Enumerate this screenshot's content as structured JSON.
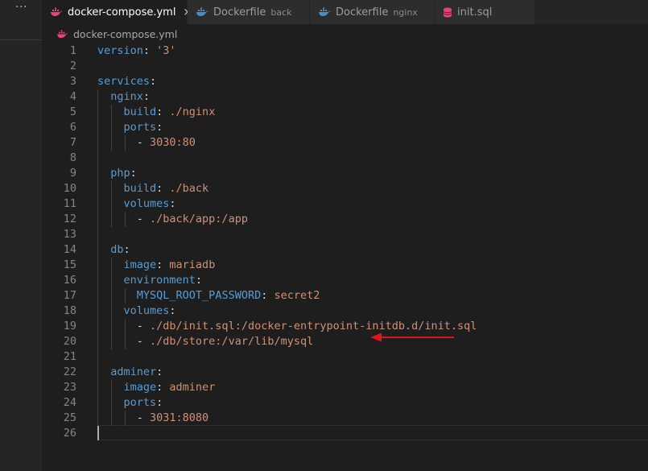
{
  "tabs": [
    {
      "label": "docker-compose.yml",
      "description": "",
      "icon": "docker-whale-icon",
      "active": true,
      "close": "×"
    },
    {
      "label": "Dockerfile",
      "description": "back",
      "icon": "docker-whale-icon",
      "active": false
    },
    {
      "label": "Dockerfile",
      "description": "nginx",
      "icon": "docker-whale-icon",
      "active": false
    },
    {
      "label": "init.sql",
      "description": "",
      "icon": "database-icon",
      "active": false
    }
  ],
  "sidebar": {
    "more_label": "···"
  },
  "breadcrumb": {
    "file": "docker-compose.yml",
    "icon": "docker-whale-icon"
  },
  "colors": {
    "key": "#569cd6",
    "string": "#ce9178",
    "punct": "#d4d4d4",
    "line_number": "#858585",
    "arrow": "#e0161e"
  },
  "code": {
    "lines": [
      {
        "n": "1",
        "tokens": [
          [
            "k",
            "version"
          ],
          [
            "p",
            ": "
          ],
          [
            "s",
            "'3'"
          ]
        ]
      },
      {
        "n": "2",
        "tokens": []
      },
      {
        "n": "3",
        "tokens": [
          [
            "k",
            "services"
          ],
          [
            "p",
            ":"
          ]
        ]
      },
      {
        "n": "4",
        "tokens": [
          [
            "p",
            "  "
          ],
          [
            "k",
            "nginx"
          ],
          [
            "p",
            ":"
          ]
        ]
      },
      {
        "n": "5",
        "tokens": [
          [
            "p",
            "    "
          ],
          [
            "k",
            "build"
          ],
          [
            "p",
            ": "
          ],
          [
            "s",
            "./nginx"
          ]
        ]
      },
      {
        "n": "6",
        "tokens": [
          [
            "p",
            "    "
          ],
          [
            "k",
            "ports"
          ],
          [
            "p",
            ":"
          ]
        ]
      },
      {
        "n": "7",
        "tokens": [
          [
            "p",
            "      - "
          ],
          [
            "s",
            "3030:80"
          ]
        ]
      },
      {
        "n": "8",
        "tokens": []
      },
      {
        "n": "9",
        "tokens": [
          [
            "p",
            "  "
          ],
          [
            "k",
            "php"
          ],
          [
            "p",
            ":"
          ]
        ]
      },
      {
        "n": "10",
        "tokens": [
          [
            "p",
            "    "
          ],
          [
            "k",
            "build"
          ],
          [
            "p",
            ": "
          ],
          [
            "s",
            "./back"
          ]
        ]
      },
      {
        "n": "11",
        "tokens": [
          [
            "p",
            "    "
          ],
          [
            "k",
            "volumes"
          ],
          [
            "p",
            ":"
          ]
        ]
      },
      {
        "n": "12",
        "tokens": [
          [
            "p",
            "      - "
          ],
          [
            "s",
            "./back/app:/app"
          ]
        ]
      },
      {
        "n": "13",
        "tokens": []
      },
      {
        "n": "14",
        "tokens": [
          [
            "p",
            "  "
          ],
          [
            "k",
            "db"
          ],
          [
            "p",
            ":"
          ]
        ]
      },
      {
        "n": "15",
        "tokens": [
          [
            "p",
            "    "
          ],
          [
            "k",
            "image"
          ],
          [
            "p",
            ": "
          ],
          [
            "s",
            "mariadb"
          ]
        ]
      },
      {
        "n": "16",
        "tokens": [
          [
            "p",
            "    "
          ],
          [
            "k",
            "environment"
          ],
          [
            "p",
            ":"
          ]
        ]
      },
      {
        "n": "17",
        "tokens": [
          [
            "p",
            "      "
          ],
          [
            "k",
            "MYSQL_ROOT_PASSWORD"
          ],
          [
            "p",
            ": "
          ],
          [
            "s",
            "secret2"
          ]
        ]
      },
      {
        "n": "18",
        "tokens": [
          [
            "p",
            "    "
          ],
          [
            "k",
            "volumes"
          ],
          [
            "p",
            ":"
          ]
        ]
      },
      {
        "n": "19",
        "tokens": [
          [
            "p",
            "      - "
          ],
          [
            "s",
            "./db/init.sql:/docker-entrypoint-initdb.d/init.sql"
          ]
        ]
      },
      {
        "n": "20",
        "tokens": [
          [
            "p",
            "      - "
          ],
          [
            "s",
            "./db/store:/var/lib/mysql"
          ]
        ]
      },
      {
        "n": "21",
        "tokens": []
      },
      {
        "n": "22",
        "tokens": [
          [
            "p",
            "  "
          ],
          [
            "k",
            "adminer"
          ],
          [
            "p",
            ":"
          ]
        ]
      },
      {
        "n": "23",
        "tokens": [
          [
            "p",
            "    "
          ],
          [
            "k",
            "image"
          ],
          [
            "p",
            ": "
          ],
          [
            "s",
            "adminer"
          ]
        ]
      },
      {
        "n": "24",
        "tokens": [
          [
            "p",
            "    "
          ],
          [
            "k",
            "ports"
          ],
          [
            "p",
            ":"
          ]
        ]
      },
      {
        "n": "25",
        "tokens": [
          [
            "p",
            "      - "
          ],
          [
            "s",
            "3031:8080"
          ]
        ]
      },
      {
        "n": "26",
        "tokens": []
      }
    ]
  }
}
